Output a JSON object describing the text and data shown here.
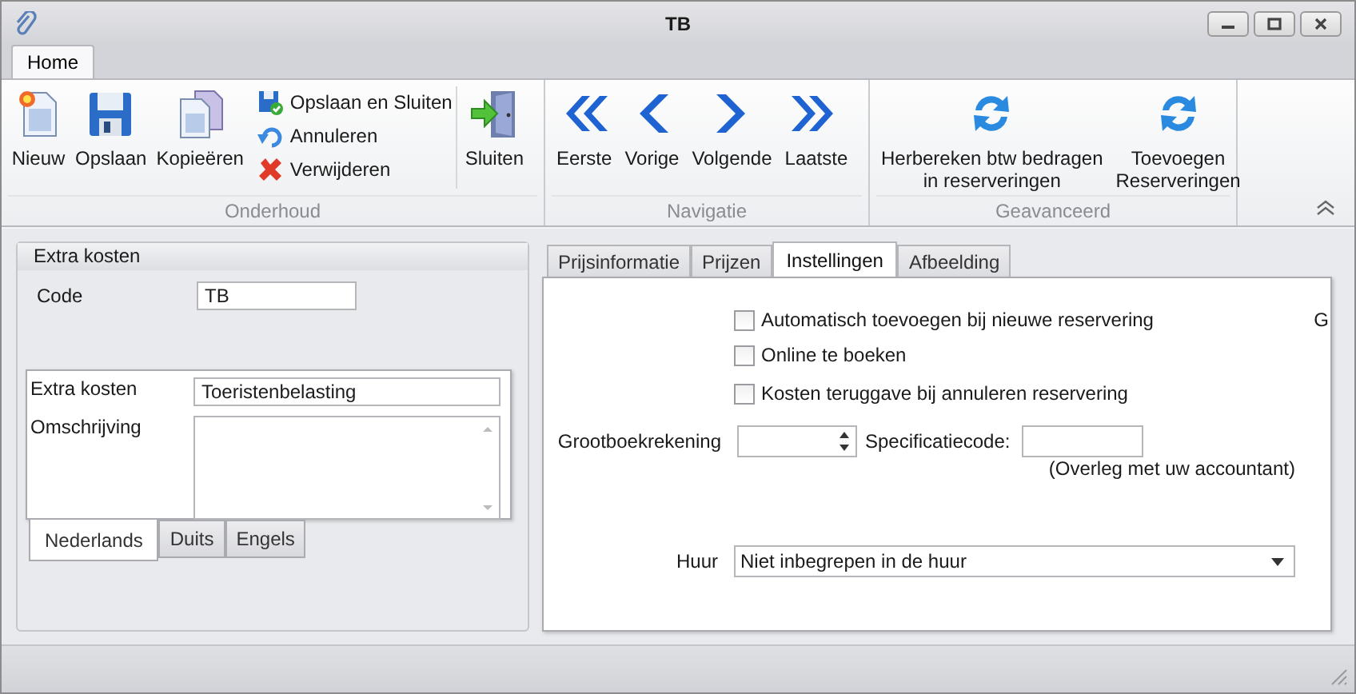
{
  "window": {
    "title": "TB"
  },
  "ribbon": {
    "tabs": [
      {
        "label": "Home",
        "selected": true
      }
    ],
    "groups": [
      {
        "label": "Onderhoud",
        "items": [
          {
            "kind": "large",
            "label": "Nieuw"
          },
          {
            "kind": "large",
            "label": "Opslaan"
          },
          {
            "kind": "large",
            "label": "Kopieëren"
          },
          {
            "kind": "stack",
            "labels": [
              "Opslaan en Sluiten",
              "Annuleren",
              "Verwijderen"
            ]
          },
          {
            "kind": "separator"
          },
          {
            "kind": "large",
            "label": "Sluiten"
          }
        ]
      },
      {
        "label": "Navigatie",
        "items": [
          {
            "kind": "large",
            "label": "Eerste"
          },
          {
            "kind": "large",
            "label": "Vorige"
          },
          {
            "kind": "large",
            "label": "Volgende"
          },
          {
            "kind": "large",
            "label": "Laatste"
          }
        ]
      },
      {
        "label": "Geavanceerd",
        "items": [
          {
            "kind": "large",
            "label": "Herbereken btw bedragen\nin reserveringen"
          },
          {
            "kind": "large",
            "label": "Toevoegen\nReserveringen"
          }
        ]
      }
    ]
  },
  "left_panel": {
    "title": "Extra kosten",
    "code_label": "Code",
    "code_value": "TB",
    "name_label": "Extra kosten",
    "name_value": "Toeristenbelasting",
    "description_label": "Omschrijving",
    "language_tabs": [
      {
        "label": "Nederlands",
        "selected": true
      },
      {
        "label": "Duits",
        "selected": false
      },
      {
        "label": "Engels",
        "selected": false
      }
    ]
  },
  "right_panel": {
    "tabs": [
      {
        "label": "Prijsinformatie",
        "selected": false
      },
      {
        "label": "Prijzen",
        "selected": false
      },
      {
        "label": "Instellingen",
        "selected": true
      },
      {
        "label": "Afbeelding",
        "selected": false
      }
    ],
    "checkboxes": [
      {
        "label": "Automatisch toevoegen bij nieuwe reservering",
        "checked": false
      },
      {
        "label": "Online te boeken",
        "checked": false
      },
      {
        "label": "Kosten teruggave bij annuleren reservering",
        "checked": false
      }
    ],
    "cut_text": "G",
    "ledger_label": "Grootboekrekening",
    "spec_label": "Specificatiecode:",
    "spec_note": "(Overleg met uw accountant)",
    "rent_label": "Huur",
    "rent_value": "Niet inbegrepen in de huur"
  }
}
